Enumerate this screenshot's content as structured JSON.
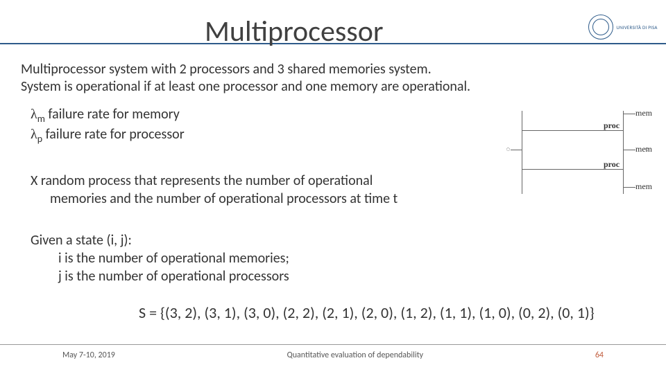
{
  "title": "Multiprocessor",
  "logo_text": "UNIVERSITÀ DI PISA",
  "intro_line1": "Multiprocessor system with  2 processors and 3 shared memories system.",
  "intro_line2": "System is operational if at least one processor and  one memory are operational.",
  "rate_mem_prefix": "λ",
  "rate_mem_sub": "m",
  "rate_mem_text": " failure rate for memory",
  "rate_proc_prefix": "λ",
  "rate_proc_sub": "p",
  "rate_proc_text": " failure rate for processor",
  "x_def_l1": "X random process that represents the  number of operational",
  "x_def_l2": "memories and the number of  operational processors at time t",
  "given_head": "Given a state (i, j):",
  "given_i": "i is the number of operational memories;",
  "given_j": "j is the number of operational processors",
  "state_space": "S = {(3, 2), (3, 1), (3, 0), (2, 2), (2, 1), (2, 0), (1, 2), (1, 1), (1, 0), (0, 2), (0, 1)}",
  "footer_date": "May 7-10, 2019",
  "footer_title": "Quantitative evaluation of dependability",
  "footer_page": "64",
  "diagram": {
    "mem": "mem",
    "proc": "proc"
  }
}
